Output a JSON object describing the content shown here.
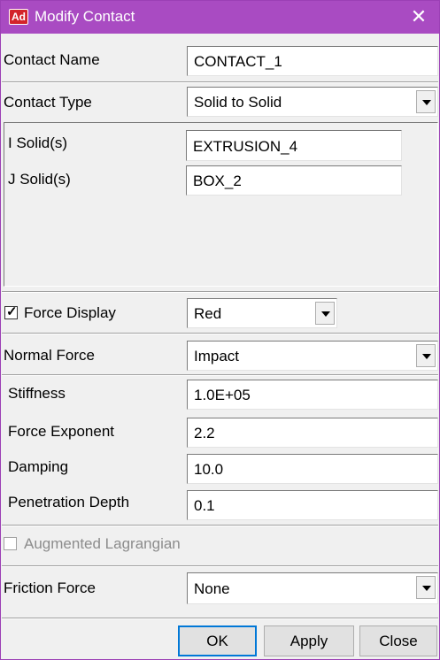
{
  "window": {
    "title": "Modify Contact",
    "app_icon_text": "Ad",
    "close_glyph": "✕",
    "titlebar_color": "#a94bc2"
  },
  "contact_name": {
    "label": "Contact Name",
    "value": "CONTACT_1"
  },
  "contact_type": {
    "label": "Contact Type",
    "value": "Solid to Solid"
  },
  "solids": {
    "i_label": "I Solid(s)",
    "i_value": "EXTRUSION_4",
    "j_label": "J Solid(s)",
    "j_value": "BOX_2"
  },
  "force_display": {
    "label": "Force Display",
    "checked": true,
    "value": "Red"
  },
  "normal_force": {
    "label": "Normal Force",
    "value": "Impact"
  },
  "impact": {
    "stiffness_label": "Stiffness",
    "stiffness_value": "1.0E+05",
    "exponent_label": "Force Exponent",
    "exponent_value": "2.2",
    "damping_label": "Damping",
    "damping_value": "10.0",
    "penetration_label": "Penetration Depth",
    "penetration_value": "0.1"
  },
  "augmented_lagrangian": {
    "label": "Augmented Lagrangian",
    "checked": false,
    "enabled": false
  },
  "friction_force": {
    "label": "Friction Force",
    "value": "None"
  },
  "buttons": {
    "ok": "OK",
    "apply": "Apply",
    "close": "Close"
  }
}
